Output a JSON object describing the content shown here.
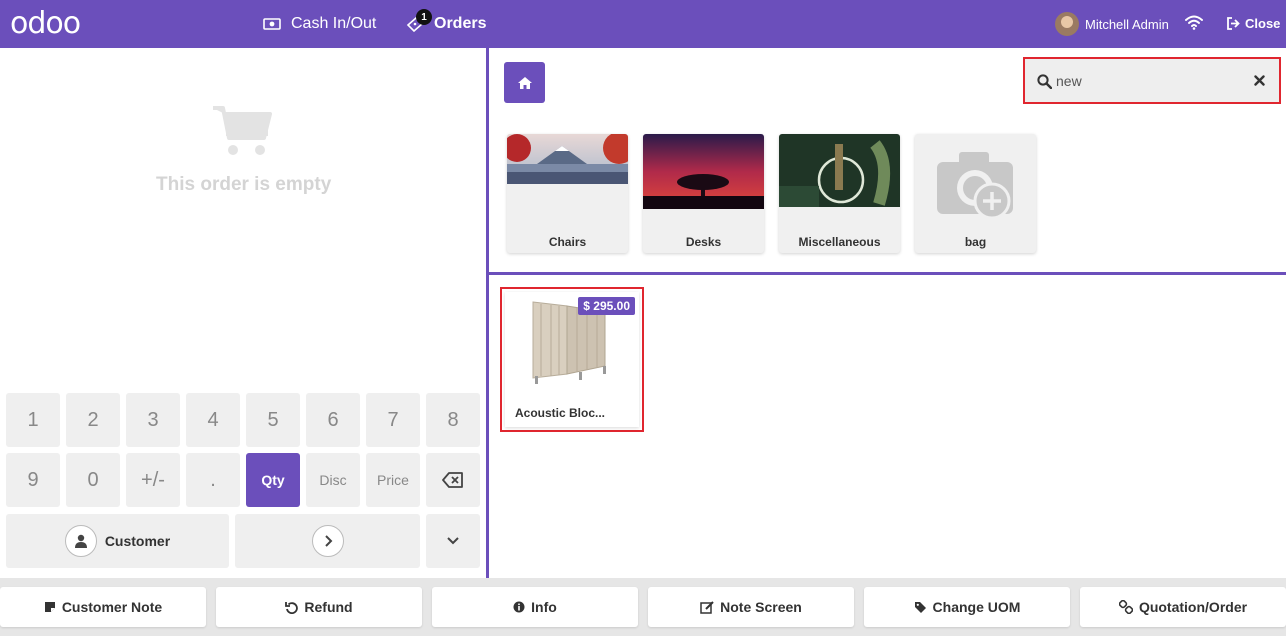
{
  "header": {
    "logo": "odoo",
    "cash_label": "Cash In/Out",
    "orders_label": "Orders",
    "orders_count": "1",
    "user_name": "Mitchell Admin",
    "close_label": "Close"
  },
  "order": {
    "empty_message": "This order is empty"
  },
  "numpad": {
    "row1": [
      "1",
      "2",
      "3",
      "4",
      "5",
      "6",
      "7",
      "8"
    ],
    "row2": [
      "9",
      "0",
      "+/-",
      "."
    ],
    "qty": "Qty",
    "disc": "Disc",
    "price": "Price",
    "customer": "Customer"
  },
  "search": {
    "value": "new"
  },
  "categories": [
    {
      "label": "Chairs"
    },
    {
      "label": "Desks"
    },
    {
      "label": "Miscellaneous"
    },
    {
      "label": "bag"
    }
  ],
  "products": [
    {
      "name": "Acoustic Bloc...",
      "price": "$ 295.00"
    }
  ],
  "controls": {
    "customer_note": "Customer Note",
    "refund": "Refund",
    "info": "Info",
    "note_screen": "Note Screen",
    "change_uom": "Change UOM",
    "quotation_order": "Quotation/Order"
  },
  "colors": {
    "brand": "#6b4fbb",
    "highlight": "#e0262f"
  }
}
